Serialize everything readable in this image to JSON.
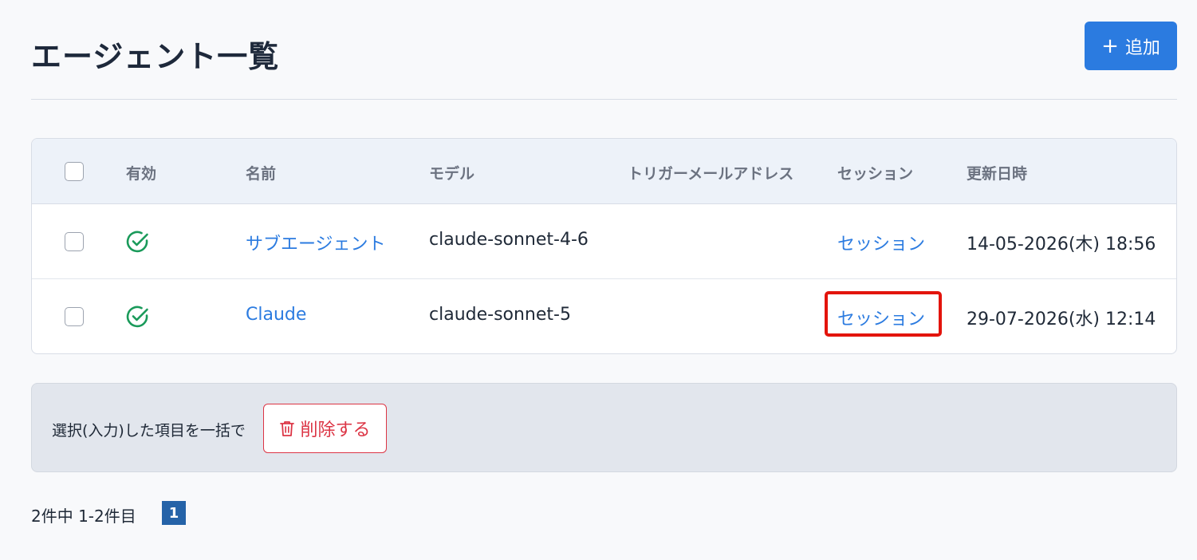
{
  "header": {
    "title": "エージェント一覧",
    "add_button_icon": "plus-icon",
    "add_button_label": "追加"
  },
  "table": {
    "columns": [
      "有効",
      "名前",
      "モデル",
      "トリガーメールアドレス",
      "セッション",
      "更新日時"
    ],
    "rows": [
      {
        "enabled": true,
        "name": "サブエージェント",
        "model": "claude-sonnet-4-6",
        "trigger_email": "",
        "session": "セッション",
        "updated": "14-05-2026(木) 18:56"
      },
      {
        "enabled": true,
        "name": "Claude",
        "model": "claude-sonnet-5",
        "trigger_email": "",
        "session": "セッション",
        "updated": "29-07-2026(水) 12:14"
      }
    ]
  },
  "bulk": {
    "label": "選択(入力)した項目を一括で",
    "delete_label": "削除する",
    "delete_icon": "trash-icon"
  },
  "pagination": {
    "info": "2件中 1-2件目",
    "current_page": "1"
  },
  "colors": {
    "accent": "#2b7be0",
    "danger": "#dc3545",
    "success": "#1a9a5a",
    "highlight": "#e3140c"
  }
}
